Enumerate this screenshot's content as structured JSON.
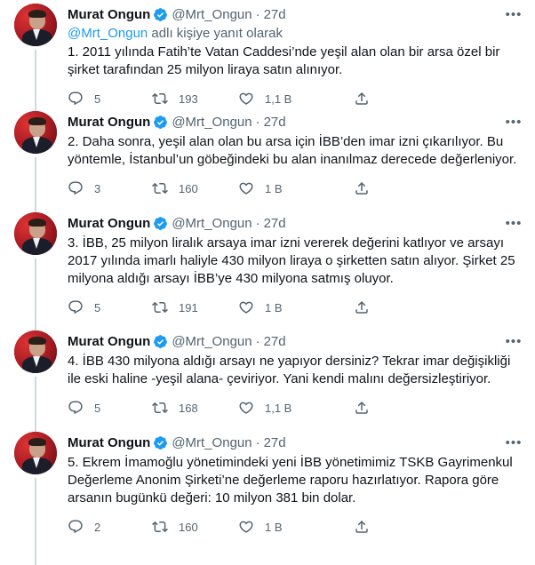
{
  "thread": {
    "replying_prefix": "@Mrt_Ongun",
    "replying_suffix": " adlı kişiye yanıt olarak",
    "tweets": [
      {
        "name": "Murat Ongun",
        "handle": "@Mrt_Ongun",
        "dot": "·",
        "time": "27d",
        "text": "1. 2011 yılında Fatih’te Vatan Caddesi’nde yeşil alan olan bir arsa özel bir şirket tarafından 25 milyon liraya satın alınıyor.",
        "replies": "5",
        "retweets": "193",
        "likes": "1,1 B"
      },
      {
        "name": "Murat Ongun",
        "handle": "@Mrt_Ongun",
        "dot": "·",
        "time": "27d",
        "text": "2. Daha sonra, yeşil alan olan bu arsa için İBB’den imar izni çıkarılıyor. Bu yöntemle, İstanbul’un göbeğindeki bu alan inanılmaz derecede değerleniyor.",
        "replies": "3",
        "retweets": "160",
        "likes": "1 B"
      },
      {
        "name": "Murat Ongun",
        "handle": "@Mrt_Ongun",
        "dot": "·",
        "time": "27d",
        "text": "3. İBB, 25 milyon liralık arsaya imar izni vererek değerini katlıyor ve arsayı 2017 yılında imarlı haliyle 430 milyon liraya o şirketten satın alıyor. Şirket 25 milyona aldığı arsayı İBB’ye 430 milyona satmış oluyor.",
        "replies": "5",
        "retweets": "191",
        "likes": "1 B"
      },
      {
        "name": "Murat Ongun",
        "handle": "@Mrt_Ongun",
        "dot": "·",
        "time": "27d",
        "text": "4. İBB 430 milyona aldığı arsayı ne yapıyor dersiniz? Tekrar imar değişikliği ile eski haline -yeşil alana- çeviriyor. Yani kendi malını değersizleştiriyor.",
        "replies": "5",
        "retweets": "168",
        "likes": "1,1 B"
      },
      {
        "name": "Murat Ongun",
        "handle": "@Mrt_Ongun",
        "dot": "·",
        "time": "27d",
        "text": "5. Ekrem İmamoğlu yönetimindeki yeni İBB yönetimimiz TSKB Gayrimenkul Değerleme Anonim Şirketi’ne değerleme raporu hazırlatıyor. Rapora göre arsanın bugünkü değeri: 10 milyon 381 bin dolar.",
        "replies": "2",
        "retweets": "160",
        "likes": "1 B"
      }
    ]
  },
  "icons": {
    "verified": "verified-badge-icon",
    "more": "more-options-icon",
    "reply": "reply-icon",
    "retweet": "retweet-icon",
    "like": "like-icon",
    "share": "share-icon"
  },
  "colors": {
    "accent": "#1d9bf0",
    "text": "#0f1419",
    "secondary": "#536471",
    "thread_line": "#cfd9de"
  }
}
